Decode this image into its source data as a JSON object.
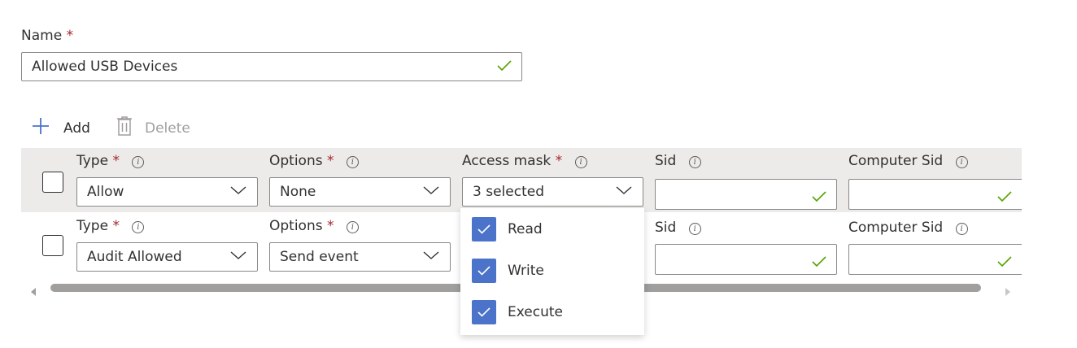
{
  "name_field": {
    "label": "Name",
    "required_mark": "*",
    "value": "Allowed USB Devices"
  },
  "toolbar": {
    "add_label": "Add",
    "delete_label": "Delete"
  },
  "columns": {
    "type": "Type",
    "options": "Options",
    "access_mask": "Access mask",
    "sid": "Sid",
    "computer_sid": "Computer Sid",
    "required_mark": "*",
    "info_glyph": "i"
  },
  "rows": [
    {
      "type": "Allow",
      "options": "None",
      "access_mask": "3 selected",
      "sid": "",
      "computer_sid": ""
    },
    {
      "type": "Audit Allowed",
      "options": "Send event",
      "sid": "",
      "computer_sid": ""
    }
  ],
  "access_mask_options": [
    {
      "label": "Read",
      "checked": true
    },
    {
      "label": "Write",
      "checked": true
    },
    {
      "label": "Execute",
      "checked": true
    }
  ],
  "colors": {
    "accent": "#4b73c9",
    "valid_check": "#57a300",
    "required": "#a4262c",
    "header_row_bg": "#edebe9"
  },
  "icons": {
    "add": "plus-icon",
    "delete": "trash-icon",
    "valid": "checkmark-icon",
    "dropdown": "chevron-down-icon",
    "info": "info-icon"
  }
}
